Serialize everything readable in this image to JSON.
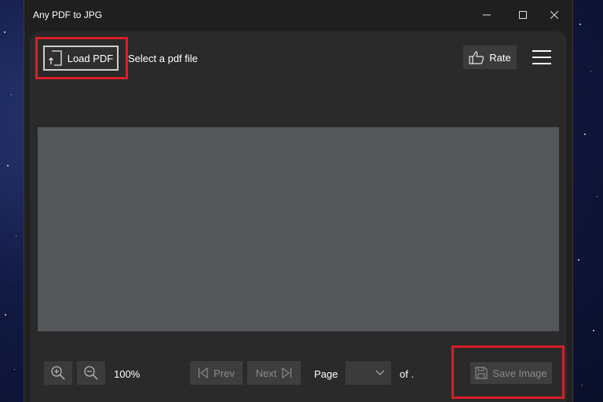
{
  "window": {
    "title": "Any PDF to JPG"
  },
  "toolbar": {
    "load_pdf_label": "Load PDF",
    "file_status": "Select a pdf file",
    "rate_label": "Rate"
  },
  "bottom_bar": {
    "zoom_level": "100%",
    "prev_label": "Prev",
    "next_label": "Next",
    "page_label": "Page",
    "page_selected": "",
    "page_of": "of .",
    "save_image_label": "Save Image"
  },
  "colors": {
    "highlight": "#d81f2a",
    "panel_bg": "#2a2a2a",
    "preview_bg": "#53575a"
  }
}
